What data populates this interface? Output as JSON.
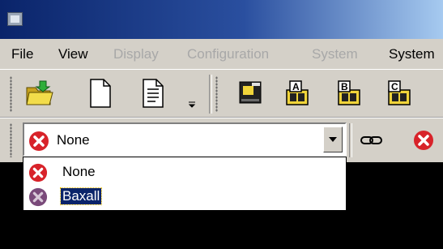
{
  "menu": {
    "items": [
      {
        "label": "File",
        "enabled": true
      },
      {
        "label": "View",
        "enabled": true
      },
      {
        "label": "Display",
        "enabled": false
      },
      {
        "label": "Configuration",
        "enabled": false
      },
      {
        "label": "System",
        "enabled": false
      },
      {
        "label": "System",
        "enabled": true
      }
    ]
  },
  "toolbar": {
    "buttons": [
      "open-folder-icon",
      "new-document-icon",
      "document-icon",
      "monitor-icon",
      "camera-a-icon",
      "camera-b-icon",
      "camera-c-icon"
    ]
  },
  "camera_toolbar": {
    "selected": "None",
    "options": [
      {
        "label": "None",
        "icon": "red-x-icon"
      },
      {
        "label": "Baxall",
        "icon": "purple-x-icon",
        "highlighted": true
      }
    ],
    "link_icon": "link-icon",
    "delete_icon": "red-x-icon"
  },
  "colors": {
    "title_start": "#0a246a",
    "title_end": "#a6caf0",
    "face": "#d4d0c8",
    "highlight": "#0a246a",
    "red": "#d8232a",
    "purple": "#7a4a7a"
  }
}
